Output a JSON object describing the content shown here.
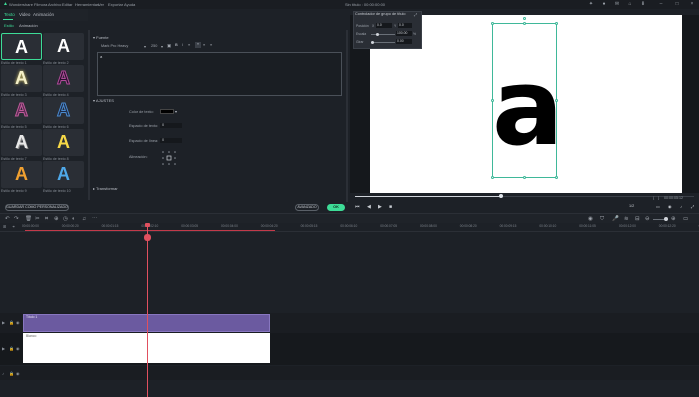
{
  "app": {
    "name": "Wondershare Filmora",
    "menu": [
      "Archivo",
      "Editar",
      "Herramientas",
      "Ver",
      "Exportar",
      "Ayuda"
    ],
    "title_window": "Sin título : 00:00:00:00"
  },
  "left_panel": {
    "tabs": [
      "Texto",
      "Video",
      "Animación"
    ],
    "subtabs": [
      "Estilo",
      "Animación"
    ],
    "presets": [
      {
        "label": "Estilo de texto 1",
        "glyph": "A",
        "color": "#ffffff"
      },
      {
        "label": "Estilo de texto 2",
        "glyph": "A",
        "color": "#ffffff"
      },
      {
        "label": "Estilo de texto 3",
        "glyph": "A",
        "color": "#f4f0c8"
      },
      {
        "label": "Estilo de texto 4",
        "glyph": "A",
        "color": "#2a0f2e"
      },
      {
        "label": "Estilo de texto 5",
        "glyph": "A",
        "color": "#5a2a52"
      },
      {
        "label": "Estilo de texto 6",
        "glyph": "A",
        "color": "#1d2a44"
      },
      {
        "label": "Estilo de texto 7",
        "glyph": "A",
        "color": "#e8e8e8"
      },
      {
        "label": "Estilo de texto 8",
        "glyph": "A",
        "color": "#f6d847"
      },
      {
        "label": "Estilo de texto 9",
        "glyph": "A",
        "color": "#f0a030"
      },
      {
        "label": "Estilo de texto 10",
        "glyph": "A",
        "color": "#4fa8e8"
      }
    ],
    "save_button": "GUARDAR COMO PERSONALIZADO"
  },
  "settings": {
    "fuente_title": "Fuente",
    "font_name": "Mark Pro Heavy",
    "font_size": "250",
    "text_value": "a",
    "ajustes_title": "AJUSTES",
    "color_label": "Color de texto:",
    "espacio_texto_label": "Espacio de texto:",
    "espacio_texto_value": "0",
    "espacio_linea_label": "Espacio de línea:",
    "espacio_linea_value": "0",
    "alineacion_label": "Alineación:",
    "transformar_title": "Transformar",
    "advanced_button": "AVANZADO",
    "ok_button": "OK",
    "text_color": "#000000"
  },
  "controller": {
    "title": "Controlador de grupo de título",
    "posicion_label": "Posición",
    "pos_x": "0.0",
    "pos_y": "0.0",
    "escala_label": "Escala",
    "escala_value": "100.00",
    "escala_unit": "%",
    "girar_label": "Girar",
    "girar_value": "0.00"
  },
  "preview": {
    "glyph": "a",
    "progress": 0.43,
    "timecode": "00:00:05:12",
    "zoom": "1/2"
  },
  "timeline": {
    "ticks": [
      "00:00:00:00",
      "00:00:00:20",
      "00:00:01:15",
      "00:00:02:10",
      "00:00:03:05",
      "00:00:04:00",
      "00:00:04:20",
      "00:00:05:15",
      "00:00:06:10",
      "00:00:07:05",
      "00:00:08:00",
      "00:00:08:20",
      "00:00:09:15",
      "00:00:10:10",
      "00:00:11:05",
      "00:00:12:00",
      "00:00:12:20",
      "00:00:13:15"
    ],
    "purple_clip_label": "Título 1",
    "white_clip_label": "Blanco"
  },
  "colors": {
    "accent": "#3ddc97",
    "playhead": "#e0505f",
    "clip_purple": "#6b5aa0"
  }
}
